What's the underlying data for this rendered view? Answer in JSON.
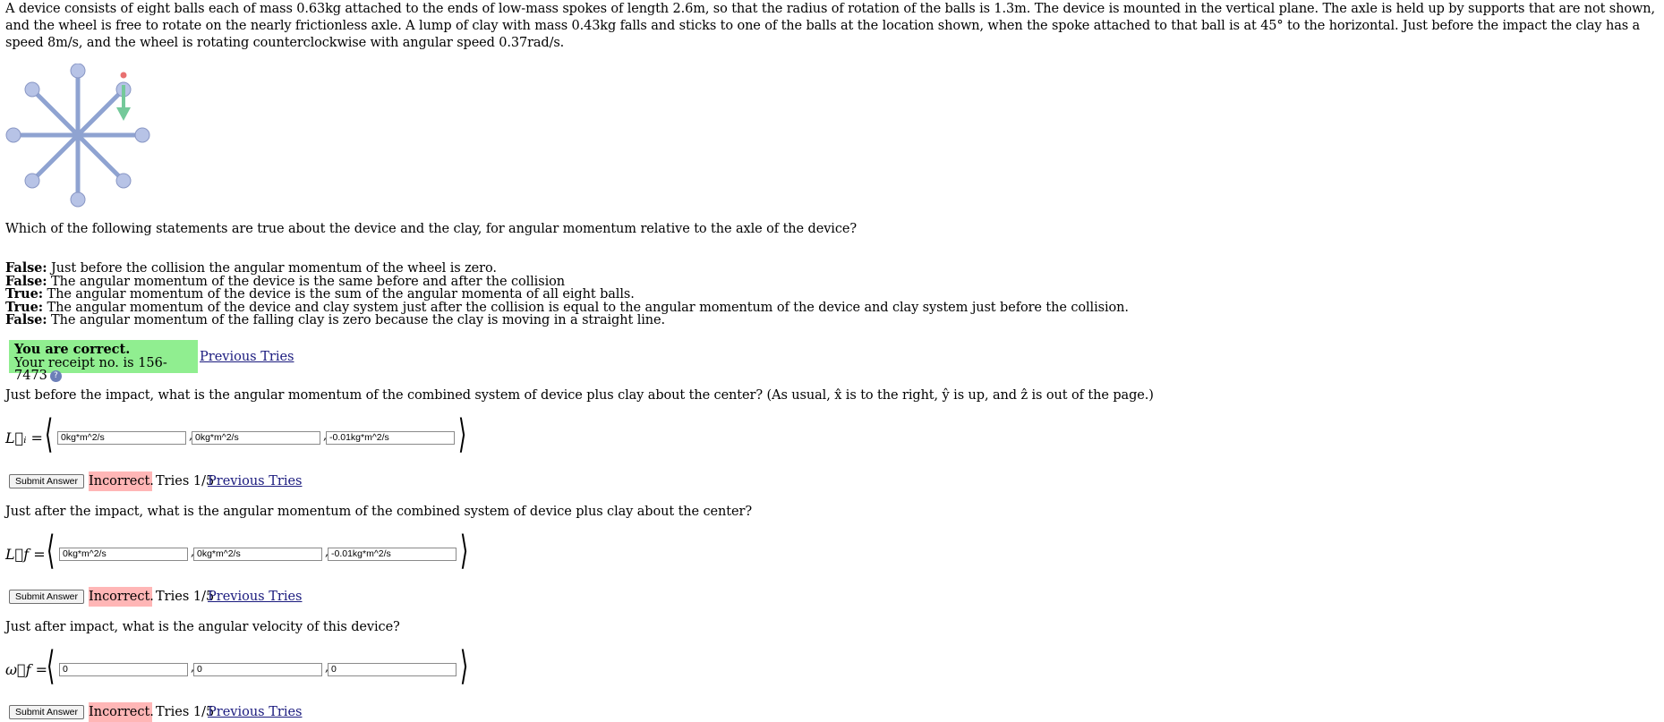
{
  "problem": {
    "text": "A device consists of eight balls each of mass 0.63kg attached to the ends of low-mass spokes of length 2.6m, so that the radius of rotation of the balls is 1.3m. The device is mounted in the vertical plane. The axle is held up by supports that are not shown, and the wheel is free to rotate on the nearly frictionless axle. A lump of clay with mass 0.43kg falls and sticks to one of the balls at the location shown, when the spoke attached to that ball is at 45° to the horizontal. Just before the impact the clay has a speed 8m/s, and the wheel is rotating counterclockwise with angular speed 0.37rad/s."
  },
  "figure": {
    "spoke_color": "#8fa3d1",
    "ball_color": "#b7c3e6",
    "clay_color": "#74c99a",
    "clay_dot_color": "#e87070"
  },
  "q1": {
    "question": "Which of the following statements are true about the device and the clay, for angular momentum relative to the axle of the device?",
    "statements": [
      {
        "verdict": "False:",
        "text": " Just before the collision the angular momentum of the wheel is zero."
      },
      {
        "verdict": "False:",
        "text": " The angular momentum of the device is the same before and after the collision"
      },
      {
        "verdict": "True:",
        "text": " The angular momentum of the device is the sum of the angular momenta of all eight balls."
      },
      {
        "verdict": "True:",
        "text": " The angular momentum of the device and clay system just after the collision is equal to the angular momentum of the device and clay system just before the collision."
      },
      {
        "verdict": "False:",
        "text": " The angular momentum of the falling clay is zero because the clay is moving in a straight line."
      }
    ],
    "feedback_title": "You are correct.",
    "feedback_receipt": "Your receipt no. is 156-7473",
    "info_icon": "?",
    "previous_tries": "Previous Tries"
  },
  "q2": {
    "question": "Just before the impact, what is the angular momentum of the combined system of device plus clay about the center? (As usual, x̂ is to the right, ŷ is up, and ẑ is out of the page.)",
    "label": "L⃗ᵢ =",
    "values": [
      "0kg*m^2/s",
      "0kg*m^2/s",
      "-0.01kg*m^2/s"
    ],
    "submit": "Submit Answer",
    "status": "Incorrect.",
    "tries": "Tries 1/5",
    "previous_tries": "Previous Tries"
  },
  "q3": {
    "question": "Just after the impact, what is the angular momentum of the combined system of device plus clay about the center?",
    "label": "L⃗f =",
    "values": [
      "0kg*m^2/s",
      "0kg*m^2/s",
      "-0.01kg*m^2/s"
    ],
    "submit": "Submit Answer",
    "status": "Incorrect.",
    "tries": "Tries 1/5",
    "previous_tries": "Previous Tries"
  },
  "q4": {
    "question": "Just after impact, what is the angular velocity of this device?",
    "label": "ω⃗f =",
    "values": [
      "0",
      "0",
      "0"
    ],
    "submit": "Submit Answer",
    "status": "Incorrect.",
    "tries": "Tries 1/5",
    "previous_tries": "Previous Tries"
  }
}
